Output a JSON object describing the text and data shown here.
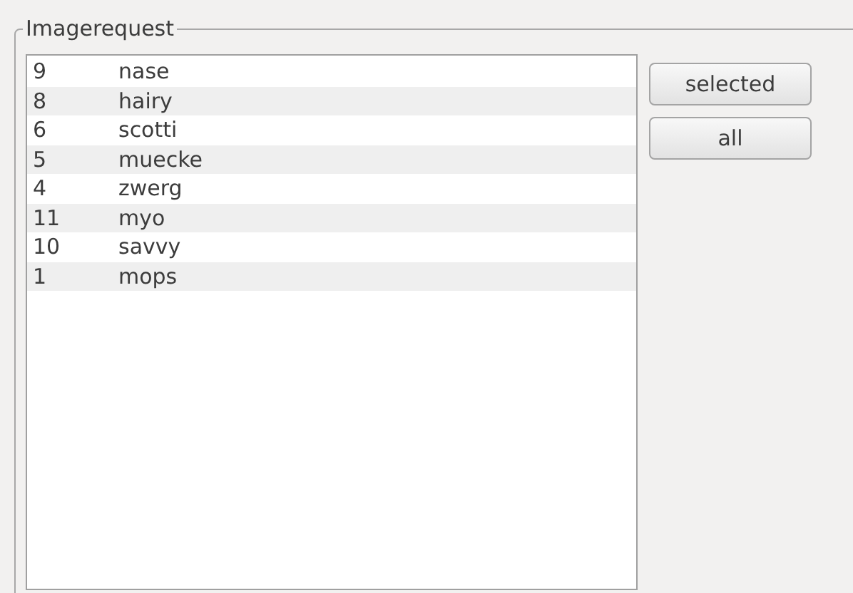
{
  "group": {
    "title": "Imagerequest"
  },
  "rows": [
    {
      "id": "9",
      "name": "nase"
    },
    {
      "id": "8",
      "name": "hairy"
    },
    {
      "id": "6",
      "name": "scotti"
    },
    {
      "id": "5",
      "name": "muecke"
    },
    {
      "id": "4",
      "name": "zwerg"
    },
    {
      "id": "11",
      "name": "myo"
    },
    {
      "id": "10",
      "name": "savvy"
    },
    {
      "id": "1",
      "name": "mops"
    }
  ],
  "buttons": [
    "selected",
    "all"
  ]
}
